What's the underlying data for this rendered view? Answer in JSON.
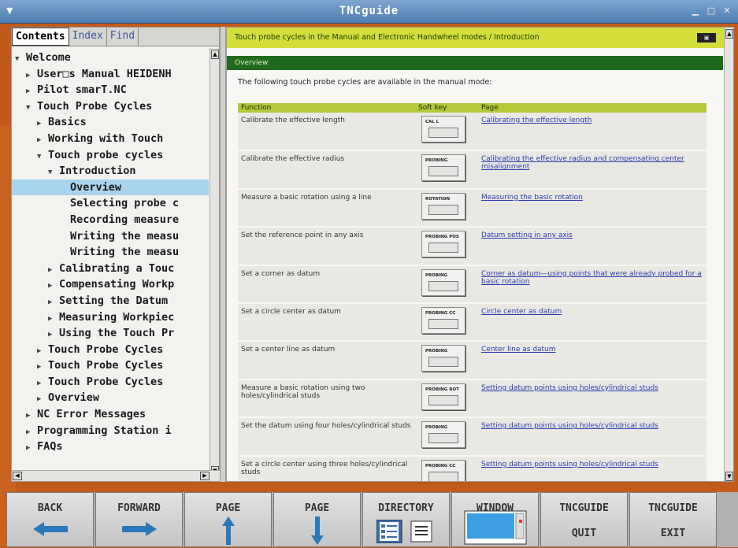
{
  "window": {
    "title": "TNCguide"
  },
  "sidebar": {
    "tabs": [
      {
        "label": "Contents",
        "active": true
      },
      {
        "label": "Index",
        "active": false
      },
      {
        "label": "Find",
        "active": false
      }
    ],
    "tree": [
      {
        "label": "Welcome",
        "indent": 0,
        "arrow": "▼",
        "selected": false
      },
      {
        "label": "User□s Manual HEIDENH",
        "indent": 1,
        "arrow": "▶",
        "selected": false
      },
      {
        "label": "Pilot smarT.NC",
        "indent": 1,
        "arrow": "▶",
        "selected": false
      },
      {
        "label": "Touch Probe Cycles",
        "indent": 1,
        "arrow": "▼",
        "selected": false
      },
      {
        "label": "Basics",
        "indent": 2,
        "arrow": "▶",
        "selected": false
      },
      {
        "label": "Working with Touch ",
        "indent": 2,
        "arrow": "▶",
        "selected": false
      },
      {
        "label": "Touch probe cycles ",
        "indent": 2,
        "arrow": "▼",
        "selected": false
      },
      {
        "label": "Introduction",
        "indent": 3,
        "arrow": "▼",
        "selected": false
      },
      {
        "label": "Overview",
        "indent": 4,
        "arrow": "",
        "selected": true
      },
      {
        "label": "Selecting probe c",
        "indent": 4,
        "arrow": "",
        "selected": false
      },
      {
        "label": "Recording measure",
        "indent": 4,
        "arrow": "",
        "selected": false
      },
      {
        "label": "Writing the measu",
        "indent": 4,
        "arrow": "",
        "selected": false
      },
      {
        "label": "Writing the measu",
        "indent": 4,
        "arrow": "",
        "selected": false
      },
      {
        "label": "Calibrating a Touc",
        "indent": 3,
        "arrow": "▶",
        "selected": false
      },
      {
        "label": "Compensating Workp",
        "indent": 3,
        "arrow": "▶",
        "selected": false
      },
      {
        "label": "Setting the Datum ",
        "indent": 3,
        "arrow": "▶",
        "selected": false
      },
      {
        "label": "Measuring Workpiec",
        "indent": 3,
        "arrow": "▶",
        "selected": false
      },
      {
        "label": "Using the Touch Pr",
        "indent": 3,
        "arrow": "▶",
        "selected": false
      },
      {
        "label": "Touch Probe Cycles ",
        "indent": 2,
        "arrow": "▶",
        "selected": false
      },
      {
        "label": "Touch Probe Cycles ",
        "indent": 2,
        "arrow": "▶",
        "selected": false
      },
      {
        "label": "Touch Probe Cycles ",
        "indent": 2,
        "arrow": "▶",
        "selected": false
      },
      {
        "label": "Overview",
        "indent": 2,
        "arrow": "▶",
        "selected": false
      },
      {
        "label": "NC Error Messages",
        "indent": 1,
        "arrow": "▶",
        "selected": false
      },
      {
        "label": "Programming Station i",
        "indent": 1,
        "arrow": "▶",
        "selected": false
      },
      {
        "label": "FAQs",
        "indent": 1,
        "arrow": "▶",
        "selected": false
      }
    ]
  },
  "content": {
    "breadcrumb": "Touch probe cycles in the Manual and Electronic Handwheel modes / Introduction",
    "section_title": "Overview",
    "intro": "The following touch probe cycles are available in the manual mode:",
    "table": {
      "headers": [
        "Function",
        "Soft key",
        "Page"
      ],
      "rows": [
        {
          "function": "Calibrate the effective length",
          "softkey": "CAL L",
          "page": "Calibrating the effective length"
        },
        {
          "function": "Calibrate the effective radius",
          "softkey": "PROBING",
          "page": "Calibrating the effective radius and compensating center misalignment"
        },
        {
          "function": "Measure a basic rotation using a line",
          "softkey": "ROTATION",
          "page": "Measuring the basic rotation"
        },
        {
          "function": "Set the reference point in any axis",
          "softkey": "PROBING POS",
          "page": "Datum setting in any axis"
        },
        {
          "function": "Set a corner as datum",
          "softkey": "PROBING",
          "page": "Corner as datum—using points that were already probed for a basic rotation"
        },
        {
          "function": "Set a circle center as datum",
          "softkey": "PROBING CC",
          "page": "Circle center as datum"
        },
        {
          "function": "Set a center line as datum",
          "softkey": "PROBING",
          "page": "Center line as datum"
        },
        {
          "function": "Measure a basic rotation using two holes/cylindrical studs",
          "softkey": "PROBING ROT",
          "page": "Setting datum points using holes/cylindrical studs"
        },
        {
          "function": "Set the datum using four holes/cylindrical studs",
          "softkey": "PROBING",
          "page": "Setting datum points using holes/cylindrical studs"
        },
        {
          "function": "Set a circle center using three holes/cylindrical studs",
          "softkey": "PROBING CC",
          "page": "Setting datum points using holes/cylindrical studs"
        }
      ]
    }
  },
  "softkeys": [
    {
      "label": "BACK",
      "label2": "",
      "icon": "arrow-left-icon"
    },
    {
      "label": "FORWARD",
      "label2": "",
      "icon": "arrow-right-icon"
    },
    {
      "label": "PAGE",
      "label2": "",
      "icon": "arrow-up-icon"
    },
    {
      "label": "PAGE",
      "label2": "",
      "icon": "arrow-down-icon"
    },
    {
      "label": "DIRECTORY",
      "label2": "",
      "icon": "directory-icon"
    },
    {
      "label": "WINDOW",
      "label2": "",
      "icon": "window-icon"
    },
    {
      "label": "TNCGUIDE",
      "label2": "QUIT",
      "icon": ""
    },
    {
      "label": "TNCGUIDE",
      "label2": "EXIT",
      "icon": ""
    }
  ],
  "colors": {
    "accent_green": "#1f6a1e",
    "breadcrumb_yellow": "#d3de3a",
    "selection_blue": "#a8d4ef",
    "icon_blue": "#2a78b8"
  }
}
